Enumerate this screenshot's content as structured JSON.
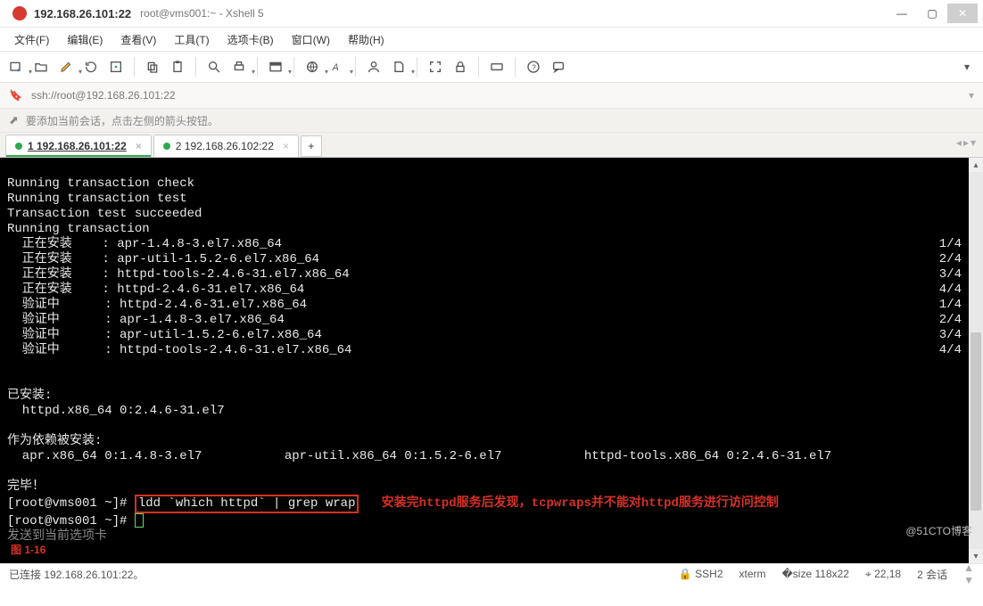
{
  "title": {
    "host": "192.168.26.101:22",
    "suffix": "root@vms001:~ - Xshell 5"
  },
  "menu": {
    "file": "文件(F)",
    "edit": "编辑(E)",
    "view": "查看(V)",
    "tools": "工具(T)",
    "tabs": "选项卡(B)",
    "window": "窗口(W)",
    "help": "帮助(H)"
  },
  "address": {
    "url": "ssh://root@192.168.26.101:22"
  },
  "hint": {
    "text": "要添加当前会话，点击左侧的箭头按钮。"
  },
  "tabs": {
    "t1": "1 192.168.26.101:22",
    "t2": "2 192.168.26.102:22",
    "add": "+"
  },
  "watermark": "@51CTO博客",
  "figlabel": "图 1-16",
  "status": {
    "conn": "已连接 192.168.26.101:22。",
    "proto": "SSH2",
    "term": "xterm",
    "size": "118x22",
    "cursor": "22,18",
    "sessions": "2 会话"
  },
  "term": {
    "l01": "Running transaction check",
    "l02": "Running transaction test",
    "l03": "Transaction test succeeded",
    "l04": "Running transaction",
    "l05": "  正在安装    : apr-1.4.8-3.el7.x86_64",
    "l05r": "1/4",
    "l06": "  正在安装    : apr-util-1.5.2-6.el7.x86_64",
    "l06r": "2/4",
    "l07": "  正在安装    : httpd-tools-2.4.6-31.el7.x86_64",
    "l07r": "3/4",
    "l08": "  正在安装    : httpd-2.4.6-31.el7.x86_64",
    "l08r": "4/4",
    "l09": "  验证中      : httpd-2.4.6-31.el7.x86_64",
    "l09r": "1/4",
    "l10": "  验证中      : apr-1.4.8-3.el7.x86_64",
    "l10r": "2/4",
    "l11": "  验证中      : apr-util-1.5.2-6.el7.x86_64",
    "l11r": "3/4",
    "l12": "  验证中      : httpd-tools-2.4.6-31.el7.x86_64",
    "l12r": "4/4",
    "l13": "",
    "l14": "已安装:",
    "l15": "  httpd.x86_64 0:2.4.6-31.el7",
    "l16": "",
    "l17": "作为依赖被安装:",
    "l18": "  apr.x86_64 0:1.4.8-3.el7           apr-util.x86_64 0:1.5.2-6.el7           httpd-tools.x86_64 0:2.4.6-31.el7",
    "l19": "",
    "l20": "完毕！",
    "p1": "[root@vms001 ~]# ",
    "cmd": "ldd `which httpd` | grep wrap",
    "anno": "   安装完httpd服务后发现，tcpwraps并不能对httpd服务进行访问控制",
    "p2": "[root@vms001 ~]# ",
    "send": "发送到当前选项卡"
  }
}
